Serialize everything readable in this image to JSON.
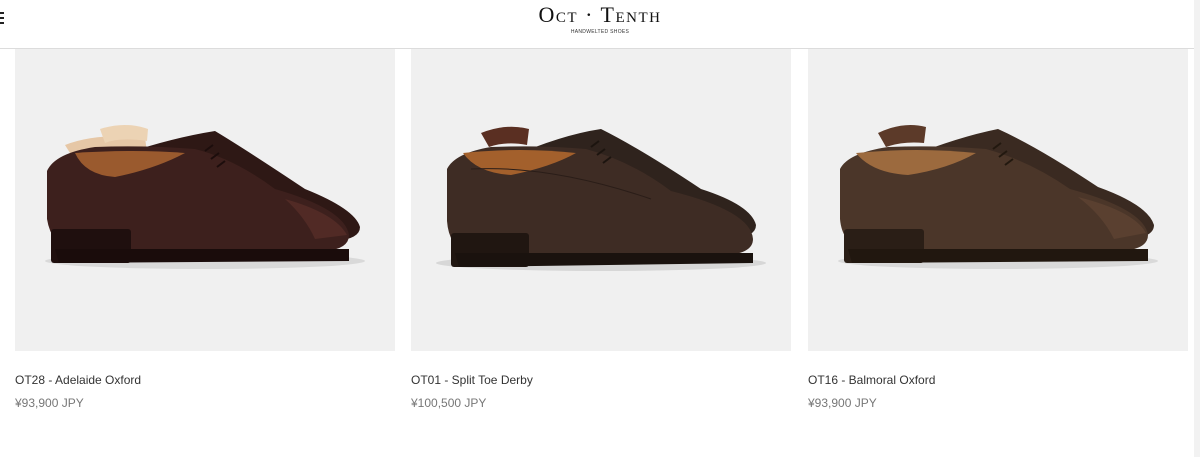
{
  "header": {
    "logo_text": "Oct · Tenth",
    "logo_subtitle": "HANDWELTED SHOES",
    "menu_icon": "hamburger-menu-icon"
  },
  "products": [
    {
      "name": "OT28 - Adelaide Oxford",
      "price": "¥93,900 JPY",
      "image": "dark-burgundy-adelaide-oxford-shoe",
      "color": "#3a1e1c"
    },
    {
      "name": "OT01 - Split Toe Derby",
      "price": "¥100,500 JPY",
      "image": "dark-brown-grain-split-toe-derby-shoe",
      "color": "#3b2a22"
    },
    {
      "name": "OT16 - Balmoral Oxford",
      "price": "¥93,900 JPY",
      "image": "brown-balmoral-oxford-shoe",
      "color": "#4a362b"
    }
  ]
}
